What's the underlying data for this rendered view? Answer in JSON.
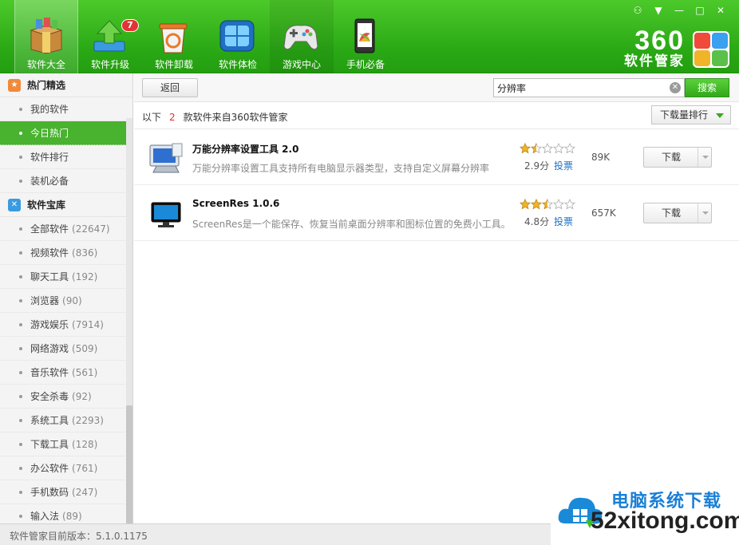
{
  "window_controls": {
    "shirt": "⚇",
    "menu": "▼",
    "minimize": "—",
    "maximize": "□",
    "close": "✕"
  },
  "top_tabs": [
    {
      "label": "软件大全",
      "icon": "box-icon"
    },
    {
      "label": "软件升级",
      "icon": "upgrade-arrow-icon",
      "badge": "7"
    },
    {
      "label": "软件卸载",
      "icon": "trash-bin-icon"
    },
    {
      "label": "软件体检",
      "icon": "monitor-check-icon"
    },
    {
      "label": "游戏中心",
      "icon": "gamepad-icon"
    },
    {
      "label": "手机必备",
      "icon": "phone-icon"
    }
  ],
  "brand": {
    "number": "360",
    "name": "软件管家"
  },
  "sidebar": {
    "section1": {
      "title": "热门精选",
      "icon": "hot-icon"
    },
    "section1_items": [
      {
        "label": "我的软件",
        "count": ""
      },
      {
        "label": "今日热门",
        "count": ""
      },
      {
        "label": "软件排行",
        "count": ""
      },
      {
        "label": "装机必备",
        "count": ""
      }
    ],
    "section2": {
      "title": "软件宝库",
      "icon": "library-icon"
    },
    "section2_items": [
      {
        "label": "全部软件",
        "count": "(22647)"
      },
      {
        "label": "视频软件",
        "count": "(836)"
      },
      {
        "label": "聊天工具",
        "count": "(192)"
      },
      {
        "label": "浏览器",
        "count": "(90)"
      },
      {
        "label": "游戏娱乐",
        "count": "(7914)"
      },
      {
        "label": "网络游戏",
        "count": "(509)"
      },
      {
        "label": "音乐软件",
        "count": "(561)"
      },
      {
        "label": "安全杀毒",
        "count": "(92)"
      },
      {
        "label": "系统工具",
        "count": "(2293)"
      },
      {
        "label": "下载工具",
        "count": "(128)"
      },
      {
        "label": "办公软件",
        "count": "(761)"
      },
      {
        "label": "手机数码",
        "count": "(247)"
      },
      {
        "label": "输入法",
        "count": "(89)"
      }
    ]
  },
  "toolbar": {
    "back_label": "返回",
    "search_value": "分辨率",
    "search_label": "搜索"
  },
  "results": {
    "prefix": "以下",
    "count": "2",
    "suffix": "款软件来自360软件管家",
    "sort_label": "下载量排行"
  },
  "software": [
    {
      "name": "万能分辨率设置工具 2.0",
      "desc": "万能分辨率设置工具支持所有电脑显示器类型，支持自定义屏幕分辨率",
      "rating": 2.9,
      "score": "2.9分",
      "vote": "投票",
      "size": "89K",
      "download": "下载",
      "icon": "monitor-settings-icon"
    },
    {
      "name": "ScreenRes 1.0.6",
      "desc": "ScreenRes是一个能保存、恢复当前桌面分辨率和图标位置的免费小工具。",
      "rating": 4.8,
      "score": "4.8分",
      "vote": "投票",
      "size": "657K",
      "download": "下载",
      "icon": "monitor-icon"
    }
  ],
  "status": {
    "version_text": "软件管家目前版本：5.1.0.1175"
  },
  "watermark": {
    "cn": "电脑系统下载",
    "en": "52xitong.com"
  },
  "colors": {
    "accent": "#2aa815",
    "active": "#49b22e",
    "link": "#1e73c8",
    "highlight_count": "#e03232",
    "star": "#f0b429"
  }
}
